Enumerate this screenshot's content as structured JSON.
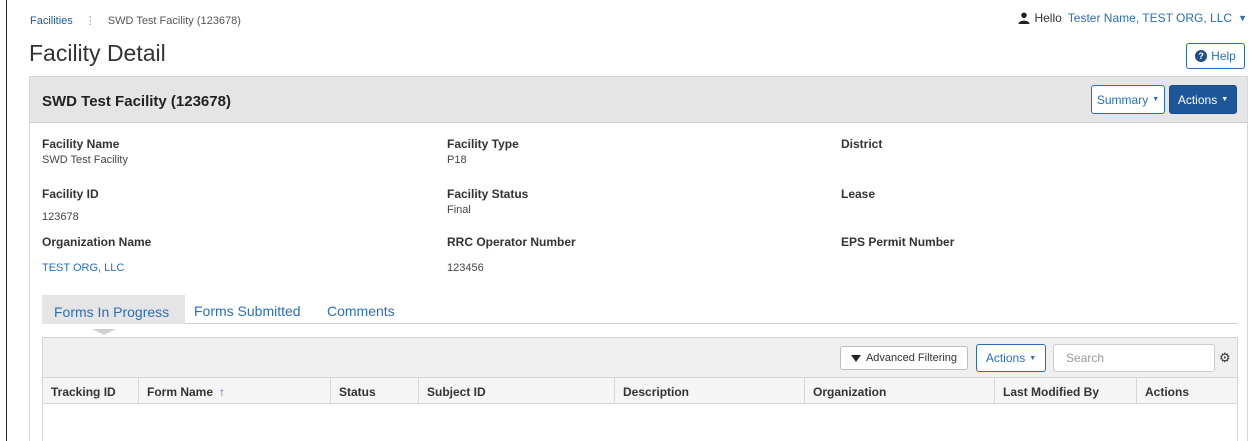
{
  "breadcrumb": {
    "root": "Facilities",
    "current": "SWD Test Facility (123678)"
  },
  "user": {
    "hello": "Hello",
    "name": "Tester Name, TEST ORG, LLC",
    "icon": "user-icon"
  },
  "page": {
    "title": "Facility Detail",
    "help_label": "Help"
  },
  "panel": {
    "title": "SWD Test Facility (123678)",
    "summary_label": "Summary",
    "actions_label": "Actions"
  },
  "fields": {
    "facility_name": {
      "label": "Facility Name",
      "value": "SWD Test Facility"
    },
    "facility_type": {
      "label": "Facility Type",
      "value": "P18"
    },
    "district": {
      "label": "District",
      "value": ""
    },
    "facility_id": {
      "label": "Facility ID",
      "value": "123678"
    },
    "facility_status": {
      "label": "Facility Status",
      "value": "Final"
    },
    "lease": {
      "label": "Lease",
      "value": ""
    },
    "organization_name": {
      "label": "Organization Name",
      "value": "TEST ORG, LLC"
    },
    "rrc_operator_number": {
      "label": "RRC Operator Number",
      "value": "123456"
    },
    "eps_permit_number": {
      "label": "EPS Permit Number",
      "value": ""
    }
  },
  "tabs": [
    {
      "label": "Forms In Progress",
      "active": true
    },
    {
      "label": "Forms Submitted",
      "active": false
    },
    {
      "label": "Comments",
      "active": false
    }
  ],
  "grid": {
    "advanced_filtering_label": "Advanced Filtering",
    "actions_label": "Actions",
    "search_placeholder": "Search",
    "columns": [
      "Tracking ID",
      "Form Name",
      "Status",
      "Subject ID",
      "Description",
      "Organization",
      "Last Modified By",
      "Actions"
    ],
    "sort_indicator": "↑"
  },
  "colors": {
    "link": "#2a6ebb",
    "primary_button": "#1e5799",
    "panel_header": "#e5e5e5"
  }
}
